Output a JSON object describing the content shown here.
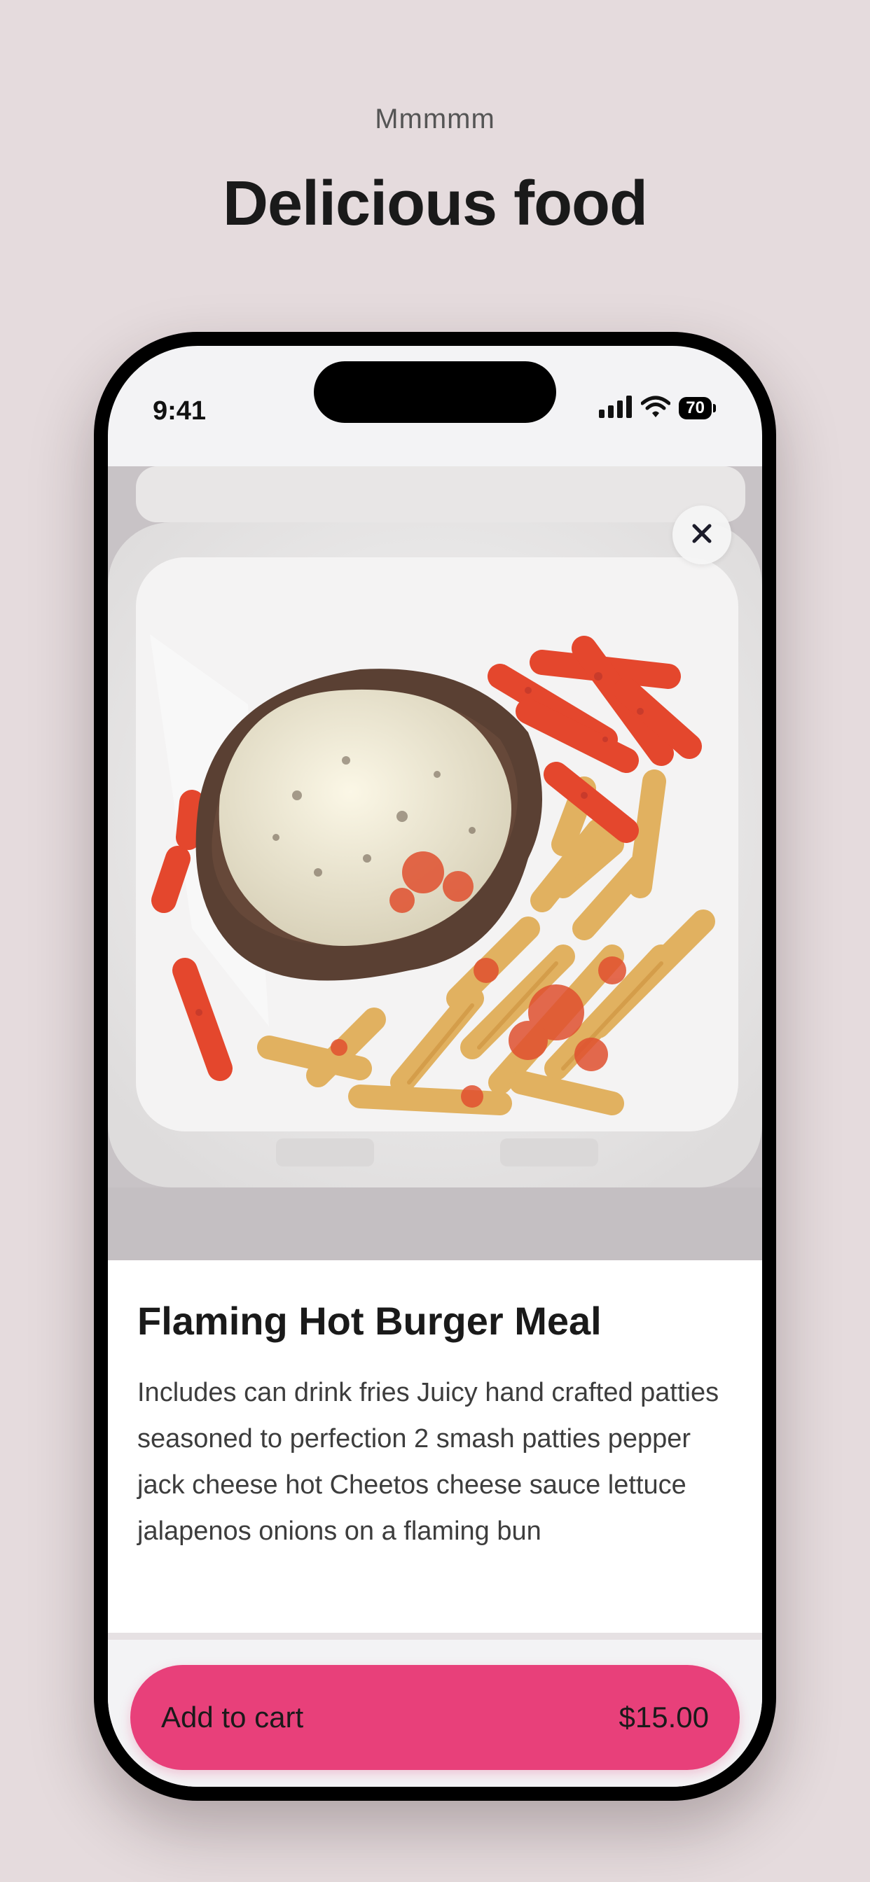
{
  "page": {
    "eyebrow": "Mmmmm",
    "headline": "Delicious food"
  },
  "status_bar": {
    "time": "9:41",
    "battery": "70",
    "icons": [
      "signal-icon",
      "wifi-icon",
      "battery-icon"
    ]
  },
  "product": {
    "image_icon": "food-photo",
    "close_icon": "close-icon",
    "title": "Flaming Hot Burger Meal",
    "description": "Includes can drink fries Juicy hand crafted patties seasoned to perfection 2 smash patties pepper jack cheese hot Cheetos cheese sauce lettuce jalapenos onions on a flaming bun"
  },
  "cart": {
    "label": "Add to cart",
    "price": "$15.00"
  },
  "colors": {
    "background": "#e5dbdd",
    "accent": "#e8407a",
    "text": "#1a1a1a"
  }
}
